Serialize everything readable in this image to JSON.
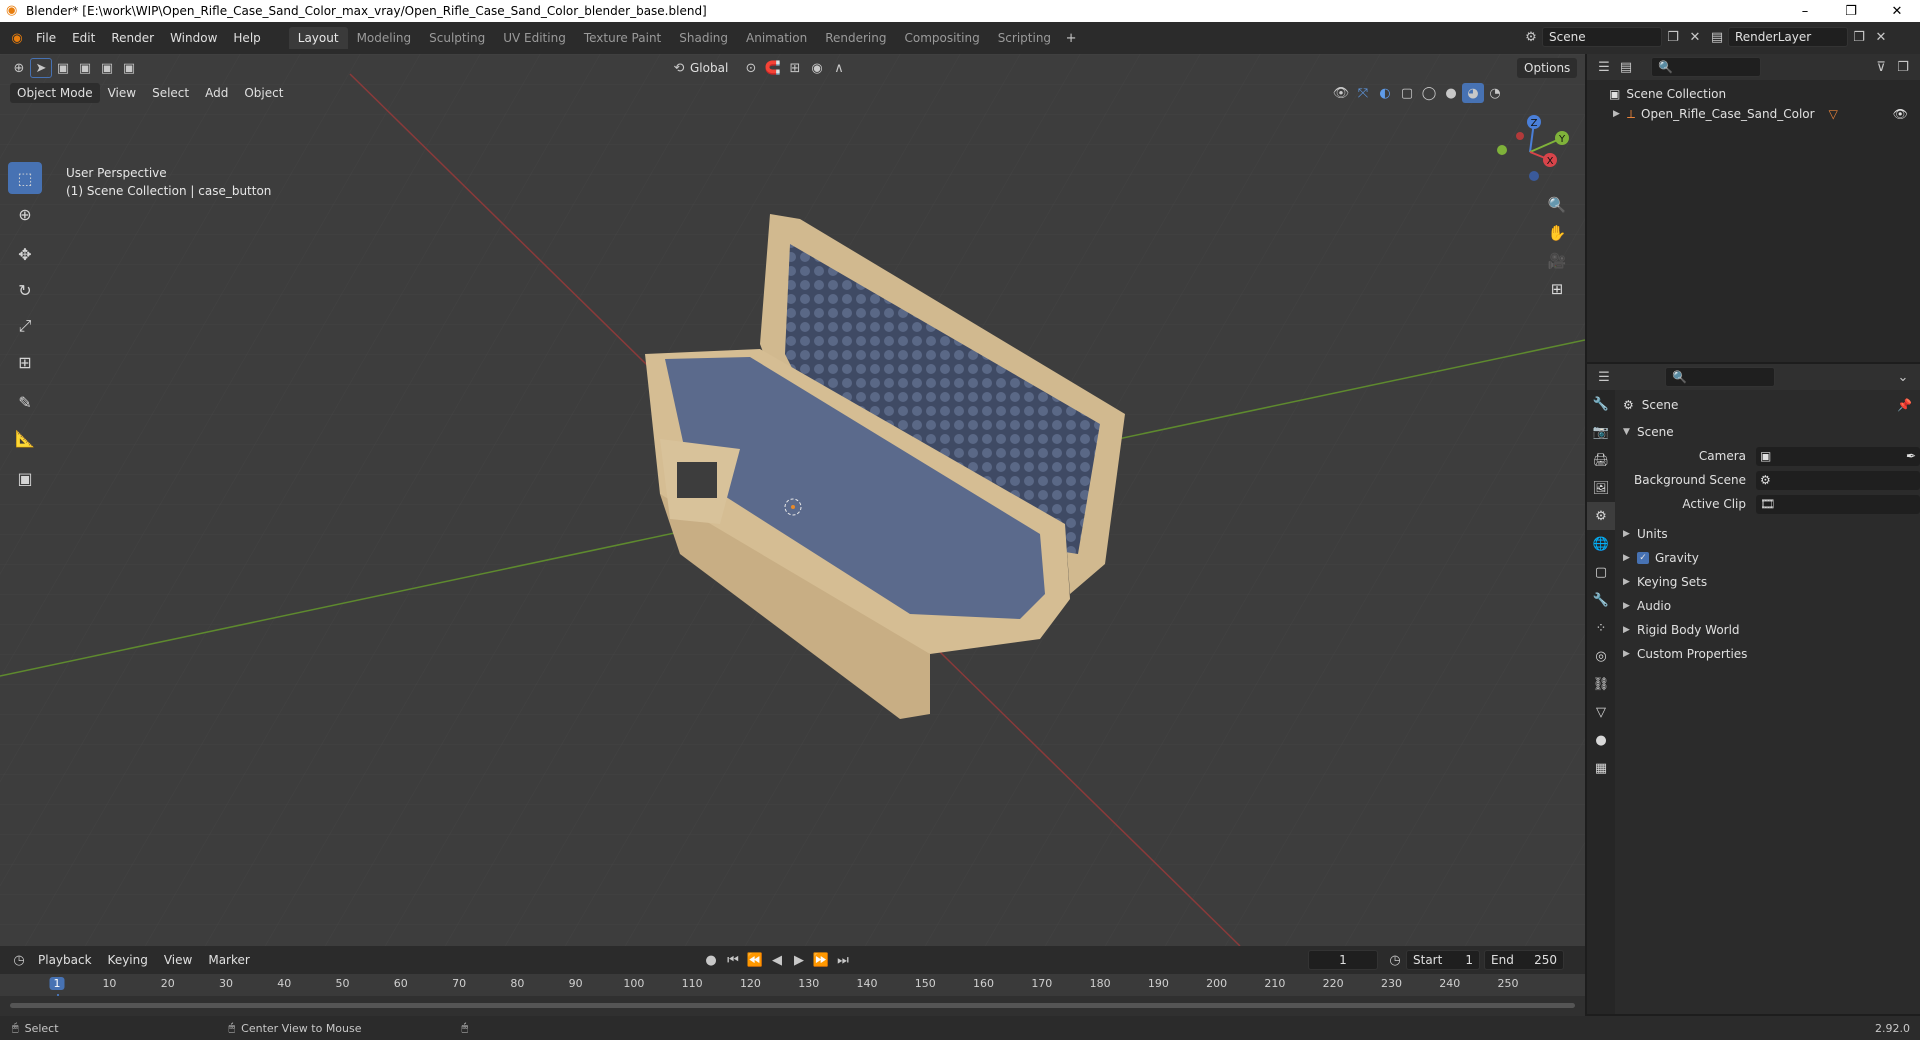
{
  "window": {
    "title": "Blender* [E:\\work\\WIP\\Open_Rifle_Case_Sand_Color_max_vray/Open_Rifle_Case_Sand_Color_blender_base.blend]",
    "minimize": "–",
    "restore": "❐",
    "close": "✕"
  },
  "menu": [
    "File",
    "Edit",
    "Render",
    "Window",
    "Help"
  ],
  "workspaces": [
    "Layout",
    "Modeling",
    "Sculpting",
    "UV Editing",
    "Texture Paint",
    "Shading",
    "Animation",
    "Rendering",
    "Compositing",
    "Scripting"
  ],
  "scene_field": "Scene",
  "renderlayer_field": "RenderLayer",
  "viewport": {
    "mode": "Object Mode",
    "menus": [
      "View",
      "Select",
      "Add",
      "Object"
    ],
    "orientation": "Global",
    "options": "Options",
    "overlay_line1": "User Perspective",
    "overlay_line2": "(1) Scene Collection | case_button",
    "gizmo": {
      "z": "Z",
      "y": "Y",
      "x": "X"
    }
  },
  "outliner": {
    "root": "Scene Collection",
    "object": "Open_Rifle_Case_Sand_Color"
  },
  "properties": {
    "context": "Scene",
    "panel": "Scene",
    "rows": [
      {
        "label": "Camera"
      },
      {
        "label": "Background Scene"
      },
      {
        "label": "Active Clip"
      }
    ],
    "sections": [
      "Units",
      "Gravity",
      "Keying Sets",
      "Audio",
      "Rigid Body World",
      "Custom Properties"
    ]
  },
  "timeline": {
    "menus": [
      "Playback",
      "Keying",
      "View",
      "Marker"
    ],
    "current_frame": "1",
    "start_label": "Start",
    "start_value": "1",
    "end_label": "End",
    "end_value": "250",
    "ticks": [
      "1",
      "10",
      "20",
      "30",
      "40",
      "50",
      "60",
      "70",
      "80",
      "90",
      "100",
      "110",
      "120",
      "130",
      "140",
      "150",
      "160",
      "170",
      "180",
      "190",
      "200",
      "210",
      "220",
      "230",
      "240",
      "250"
    ]
  },
  "status": {
    "left": "Select",
    "middle": "Center View to Mouse",
    "version": "2.92.0"
  }
}
